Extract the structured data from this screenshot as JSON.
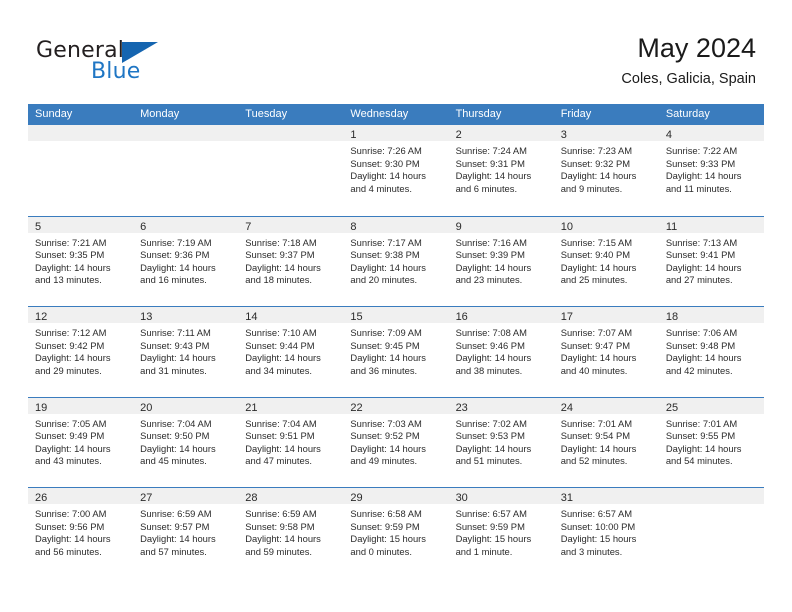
{
  "brand": {
    "word_one": "General",
    "word_two": "Blue",
    "flag_icon": "triangle-flag-icon"
  },
  "header": {
    "title": "May 2024",
    "subtitle": "Coles, Galicia, Spain"
  },
  "theme": {
    "header_blue": "#3a7cbe",
    "brand_blue": "#1f76c4",
    "day_band_gray": "#f0f0f0",
    "text": "#2b2b2b"
  },
  "weekdays": [
    "Sunday",
    "Monday",
    "Tuesday",
    "Wednesday",
    "Thursday",
    "Friday",
    "Saturday"
  ],
  "weeks": [
    [
      {
        "day": "",
        "empty": true
      },
      {
        "day": "",
        "empty": true
      },
      {
        "day": "",
        "empty": true
      },
      {
        "day": "1",
        "sunrise": "Sunrise: 7:26 AM",
        "sunset": "Sunset: 9:30 PM",
        "daylight1": "Daylight: 14 hours",
        "daylight2": "and 4 minutes."
      },
      {
        "day": "2",
        "sunrise": "Sunrise: 7:24 AM",
        "sunset": "Sunset: 9:31 PM",
        "daylight1": "Daylight: 14 hours",
        "daylight2": "and 6 minutes."
      },
      {
        "day": "3",
        "sunrise": "Sunrise: 7:23 AM",
        "sunset": "Sunset: 9:32 PM",
        "daylight1": "Daylight: 14 hours",
        "daylight2": "and 9 minutes."
      },
      {
        "day": "4",
        "sunrise": "Sunrise: 7:22 AM",
        "sunset": "Sunset: 9:33 PM",
        "daylight1": "Daylight: 14 hours",
        "daylight2": "and 11 minutes."
      }
    ],
    [
      {
        "day": "5",
        "sunrise": "Sunrise: 7:21 AM",
        "sunset": "Sunset: 9:35 PM",
        "daylight1": "Daylight: 14 hours",
        "daylight2": "and 13 minutes."
      },
      {
        "day": "6",
        "sunrise": "Sunrise: 7:19 AM",
        "sunset": "Sunset: 9:36 PM",
        "daylight1": "Daylight: 14 hours",
        "daylight2": "and 16 minutes."
      },
      {
        "day": "7",
        "sunrise": "Sunrise: 7:18 AM",
        "sunset": "Sunset: 9:37 PM",
        "daylight1": "Daylight: 14 hours",
        "daylight2": "and 18 minutes."
      },
      {
        "day": "8",
        "sunrise": "Sunrise: 7:17 AM",
        "sunset": "Sunset: 9:38 PM",
        "daylight1": "Daylight: 14 hours",
        "daylight2": "and 20 minutes."
      },
      {
        "day": "9",
        "sunrise": "Sunrise: 7:16 AM",
        "sunset": "Sunset: 9:39 PM",
        "daylight1": "Daylight: 14 hours",
        "daylight2": "and 23 minutes."
      },
      {
        "day": "10",
        "sunrise": "Sunrise: 7:15 AM",
        "sunset": "Sunset: 9:40 PM",
        "daylight1": "Daylight: 14 hours",
        "daylight2": "and 25 minutes."
      },
      {
        "day": "11",
        "sunrise": "Sunrise: 7:13 AM",
        "sunset": "Sunset: 9:41 PM",
        "daylight1": "Daylight: 14 hours",
        "daylight2": "and 27 minutes."
      }
    ],
    [
      {
        "day": "12",
        "sunrise": "Sunrise: 7:12 AM",
        "sunset": "Sunset: 9:42 PM",
        "daylight1": "Daylight: 14 hours",
        "daylight2": "and 29 minutes."
      },
      {
        "day": "13",
        "sunrise": "Sunrise: 7:11 AM",
        "sunset": "Sunset: 9:43 PM",
        "daylight1": "Daylight: 14 hours",
        "daylight2": "and 31 minutes."
      },
      {
        "day": "14",
        "sunrise": "Sunrise: 7:10 AM",
        "sunset": "Sunset: 9:44 PM",
        "daylight1": "Daylight: 14 hours",
        "daylight2": "and 34 minutes."
      },
      {
        "day": "15",
        "sunrise": "Sunrise: 7:09 AM",
        "sunset": "Sunset: 9:45 PM",
        "daylight1": "Daylight: 14 hours",
        "daylight2": "and 36 minutes."
      },
      {
        "day": "16",
        "sunrise": "Sunrise: 7:08 AM",
        "sunset": "Sunset: 9:46 PM",
        "daylight1": "Daylight: 14 hours",
        "daylight2": "and 38 minutes."
      },
      {
        "day": "17",
        "sunrise": "Sunrise: 7:07 AM",
        "sunset": "Sunset: 9:47 PM",
        "daylight1": "Daylight: 14 hours",
        "daylight2": "and 40 minutes."
      },
      {
        "day": "18",
        "sunrise": "Sunrise: 7:06 AM",
        "sunset": "Sunset: 9:48 PM",
        "daylight1": "Daylight: 14 hours",
        "daylight2": "and 42 minutes."
      }
    ],
    [
      {
        "day": "19",
        "sunrise": "Sunrise: 7:05 AM",
        "sunset": "Sunset: 9:49 PM",
        "daylight1": "Daylight: 14 hours",
        "daylight2": "and 43 minutes."
      },
      {
        "day": "20",
        "sunrise": "Sunrise: 7:04 AM",
        "sunset": "Sunset: 9:50 PM",
        "daylight1": "Daylight: 14 hours",
        "daylight2": "and 45 minutes."
      },
      {
        "day": "21",
        "sunrise": "Sunrise: 7:04 AM",
        "sunset": "Sunset: 9:51 PM",
        "daylight1": "Daylight: 14 hours",
        "daylight2": "and 47 minutes."
      },
      {
        "day": "22",
        "sunrise": "Sunrise: 7:03 AM",
        "sunset": "Sunset: 9:52 PM",
        "daylight1": "Daylight: 14 hours",
        "daylight2": "and 49 minutes."
      },
      {
        "day": "23",
        "sunrise": "Sunrise: 7:02 AM",
        "sunset": "Sunset: 9:53 PM",
        "daylight1": "Daylight: 14 hours",
        "daylight2": "and 51 minutes."
      },
      {
        "day": "24",
        "sunrise": "Sunrise: 7:01 AM",
        "sunset": "Sunset: 9:54 PM",
        "daylight1": "Daylight: 14 hours",
        "daylight2": "and 52 minutes."
      },
      {
        "day": "25",
        "sunrise": "Sunrise: 7:01 AM",
        "sunset": "Sunset: 9:55 PM",
        "daylight1": "Daylight: 14 hours",
        "daylight2": "and 54 minutes."
      }
    ],
    [
      {
        "day": "26",
        "sunrise": "Sunrise: 7:00 AM",
        "sunset": "Sunset: 9:56 PM",
        "daylight1": "Daylight: 14 hours",
        "daylight2": "and 56 minutes."
      },
      {
        "day": "27",
        "sunrise": "Sunrise: 6:59 AM",
        "sunset": "Sunset: 9:57 PM",
        "daylight1": "Daylight: 14 hours",
        "daylight2": "and 57 minutes."
      },
      {
        "day": "28",
        "sunrise": "Sunrise: 6:59 AM",
        "sunset": "Sunset: 9:58 PM",
        "daylight1": "Daylight: 14 hours",
        "daylight2": "and 59 minutes."
      },
      {
        "day": "29",
        "sunrise": "Sunrise: 6:58 AM",
        "sunset": "Sunset: 9:59 PM",
        "daylight1": "Daylight: 15 hours",
        "daylight2": "and 0 minutes."
      },
      {
        "day": "30",
        "sunrise": "Sunrise: 6:57 AM",
        "sunset": "Sunset: 9:59 PM",
        "daylight1": "Daylight: 15 hours",
        "daylight2": "and 1 minute."
      },
      {
        "day": "31",
        "sunrise": "Sunrise: 6:57 AM",
        "sunset": "Sunset: 10:00 PM",
        "daylight1": "Daylight: 15 hours",
        "daylight2": "and 3 minutes."
      },
      {
        "day": "",
        "empty": true
      }
    ]
  ]
}
